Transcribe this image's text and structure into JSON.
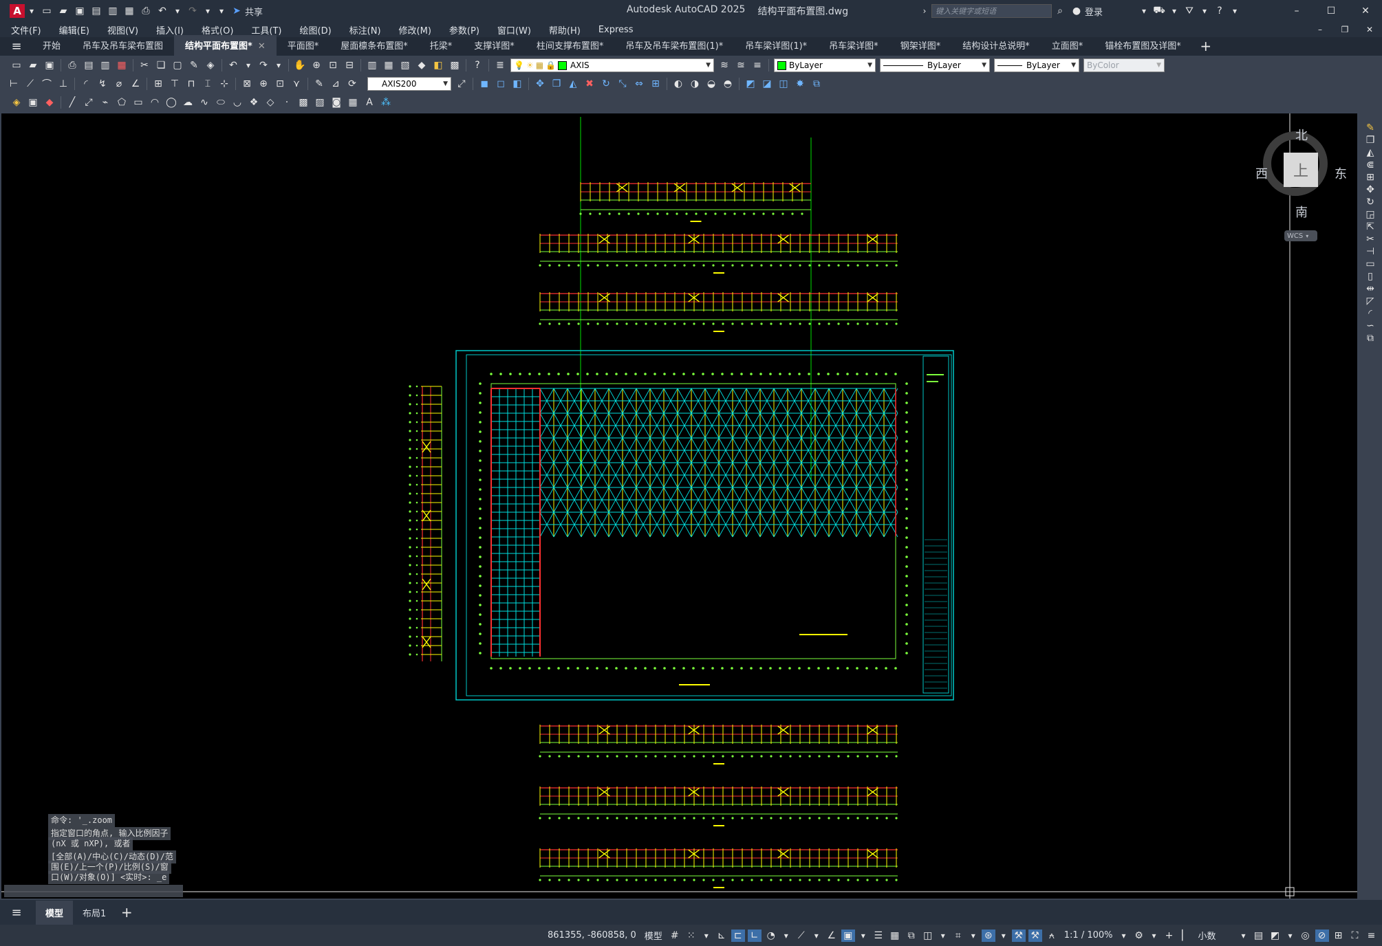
{
  "app": {
    "logo_letter": "A",
    "title": "Autodesk AutoCAD 2025",
    "file_name": "结构平面布置图.dwg",
    "share_label": "共享",
    "search_placeholder": "键入关键字或短语",
    "login_label": "登录"
  },
  "menus": [
    "文件(F)",
    "编辑(E)",
    "视图(V)",
    "插入(I)",
    "格式(O)",
    "工具(T)",
    "绘图(D)",
    "标注(N)",
    "修改(M)",
    "参数(P)",
    "窗口(W)",
    "帮助(H)",
    "Express"
  ],
  "tabs": [
    {
      "label": "开始",
      "active": false
    },
    {
      "label": "吊车及吊车梁布置图",
      "active": false
    },
    {
      "label": "结构平面布置图*",
      "active": true
    },
    {
      "label": "平面图*",
      "active": false
    },
    {
      "label": "屋面檩条布置图*",
      "active": false
    },
    {
      "label": "托梁*",
      "active": false
    },
    {
      "label": "支撑详图*",
      "active": false
    },
    {
      "label": "柱间支撑布置图*",
      "active": false
    },
    {
      "label": "吊车及吊车梁布置图(1)*",
      "active": false
    },
    {
      "label": "吊车梁详图(1)*",
      "active": false
    },
    {
      "label": "吊车梁详图*",
      "active": false
    },
    {
      "label": "钢架详图*",
      "active": false
    },
    {
      "label": "结构设计总说明*",
      "active": false
    },
    {
      "label": "立面图*",
      "active": false
    },
    {
      "label": "锚栓布置图及详图*",
      "active": false
    }
  ],
  "properties": {
    "layer": "AXIS",
    "color": "ByLayer",
    "linetype": "ByLayer",
    "lineweight": "ByLayer",
    "plotstyle": "ByColor",
    "dimstyle": "AXIS200"
  },
  "viewcube": {
    "north": "北",
    "south": "南",
    "east": "东",
    "west": "西",
    "face": "上",
    "wcs": "WCS"
  },
  "command": {
    "line1": "命令: '_.zoom",
    "line2": "指定窗口的角点, 输入比例因子",
    "line3": "(nX 或 nXP), 或者",
    "line4": "[全部(A)/中心(C)/动态(D)/范",
    "line5": "围(E)/上一个(P)/比例(S)/窗",
    "line6": "口(W)/对象(O)] <实时>: _e"
  },
  "layout_tabs": [
    "模型",
    "布局1"
  ],
  "status": {
    "coords": "861355, -860858, 0",
    "model": "模型",
    "scale": "1:1 / 100%",
    "units": "小数"
  },
  "colors": {
    "titlebar": "#27303d",
    "toolbar": "#3a4250",
    "canvas": "#000000",
    "frame": "#00c8c8",
    "brace": "#00e0e0",
    "column": "#ffff00",
    "axis_dot": "#7cff3c",
    "beam": "#ff3030",
    "layer_swatch": "#00ff00"
  }
}
